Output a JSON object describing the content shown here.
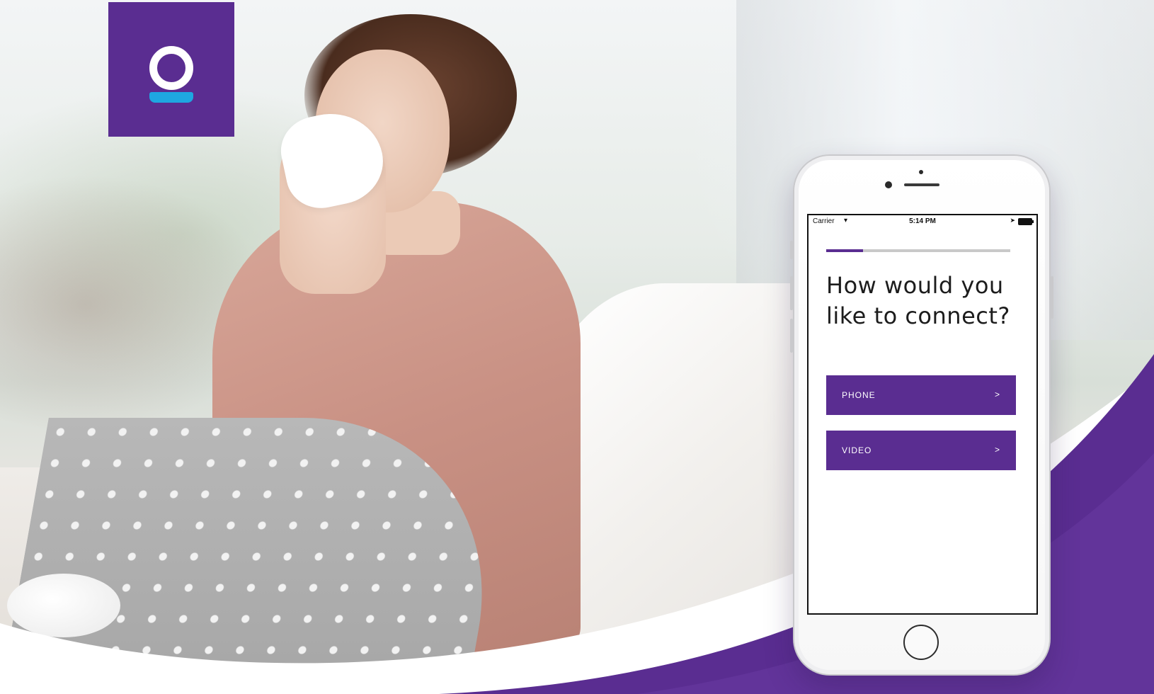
{
  "brand": {
    "logo_color": "#5a2d91",
    "logo_accent": "#1ea7e1"
  },
  "phone": {
    "status_bar": {
      "carrier": "Carrier",
      "time": "5:14 PM",
      "wifi_icon": "▾",
      "location_icon": "➤"
    },
    "progress": 0.2,
    "question": "How would you like to connect?",
    "options": [
      {
        "label": "PHONE",
        "chevron": ">"
      },
      {
        "label": "VIDEO",
        "chevron": ">"
      }
    ]
  },
  "colors": {
    "accent_purple": "#5a2d91",
    "progress_track": "#c9c9c9"
  }
}
